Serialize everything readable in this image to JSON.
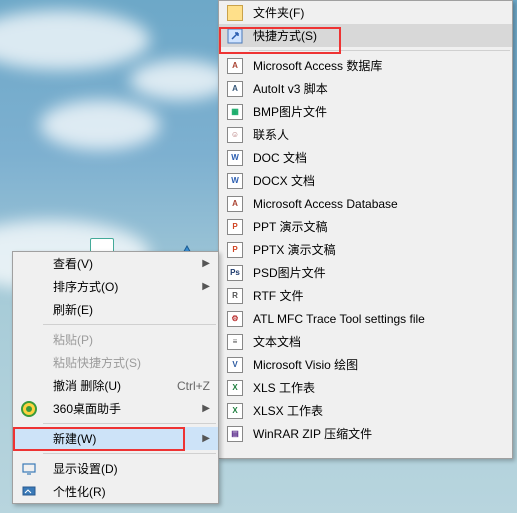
{
  "context_menu": {
    "items": [
      {
        "label": "查看(V)",
        "has_submenu": true
      },
      {
        "label": "排序方式(O)",
        "has_submenu": true
      },
      {
        "label": "刷新(E)"
      },
      {
        "sep": true
      },
      {
        "label": "粘贴(P)",
        "disabled": true
      },
      {
        "label": "粘贴快捷方式(S)",
        "disabled": true
      },
      {
        "label": "撤消 删除(U)",
        "shortcut": "Ctrl+Z"
      },
      {
        "label": "360桌面助手",
        "icon": "360",
        "has_submenu": true
      },
      {
        "sep": true
      },
      {
        "label": "新建(W)",
        "has_submenu": true,
        "hovered": true,
        "annotated": true
      },
      {
        "sep": true
      },
      {
        "label": "显示设置(D)",
        "icon": "display"
      },
      {
        "label": "个性化(R)",
        "icon": "personalize"
      }
    ]
  },
  "new_submenu": {
    "items": [
      {
        "label": "文件夹(F)",
        "icon": "folder"
      },
      {
        "label": "快捷方式(S)",
        "icon": "shortcut",
        "highlighted": true,
        "annotated": true
      },
      {
        "sep": true
      },
      {
        "label": "Microsoft Access 数据库",
        "icon": "access"
      },
      {
        "label": "AutoIt v3 脚本",
        "icon": "au3"
      },
      {
        "label": "BMP图片文件",
        "icon": "bmp"
      },
      {
        "label": "联系人",
        "icon": "contact"
      },
      {
        "label": "DOC 文档",
        "icon": "doc"
      },
      {
        "label": "DOCX 文档",
        "icon": "docx"
      },
      {
        "label": "Microsoft Access Database",
        "icon": "access"
      },
      {
        "label": "PPT 演示文稿",
        "icon": "ppt"
      },
      {
        "label": "PPTX 演示文稿",
        "icon": "pptx"
      },
      {
        "label": "PSD图片文件",
        "icon": "psd"
      },
      {
        "label": "RTF 文件",
        "icon": "rtf"
      },
      {
        "label": "ATL MFC Trace Tool settings file",
        "icon": "atl"
      },
      {
        "label": "文本文档",
        "icon": "txt"
      },
      {
        "label": "Microsoft Visio 绘图",
        "icon": "visio"
      },
      {
        "label": "XLS 工作表",
        "icon": "xls"
      },
      {
        "label": "XLSX 工作表",
        "icon": "xlsx"
      },
      {
        "label": "WinRAR ZIP 压缩文件",
        "icon": "rar"
      }
    ]
  },
  "annotations": {
    "main_highlight_index": 9,
    "sub_highlight_index": 1
  }
}
